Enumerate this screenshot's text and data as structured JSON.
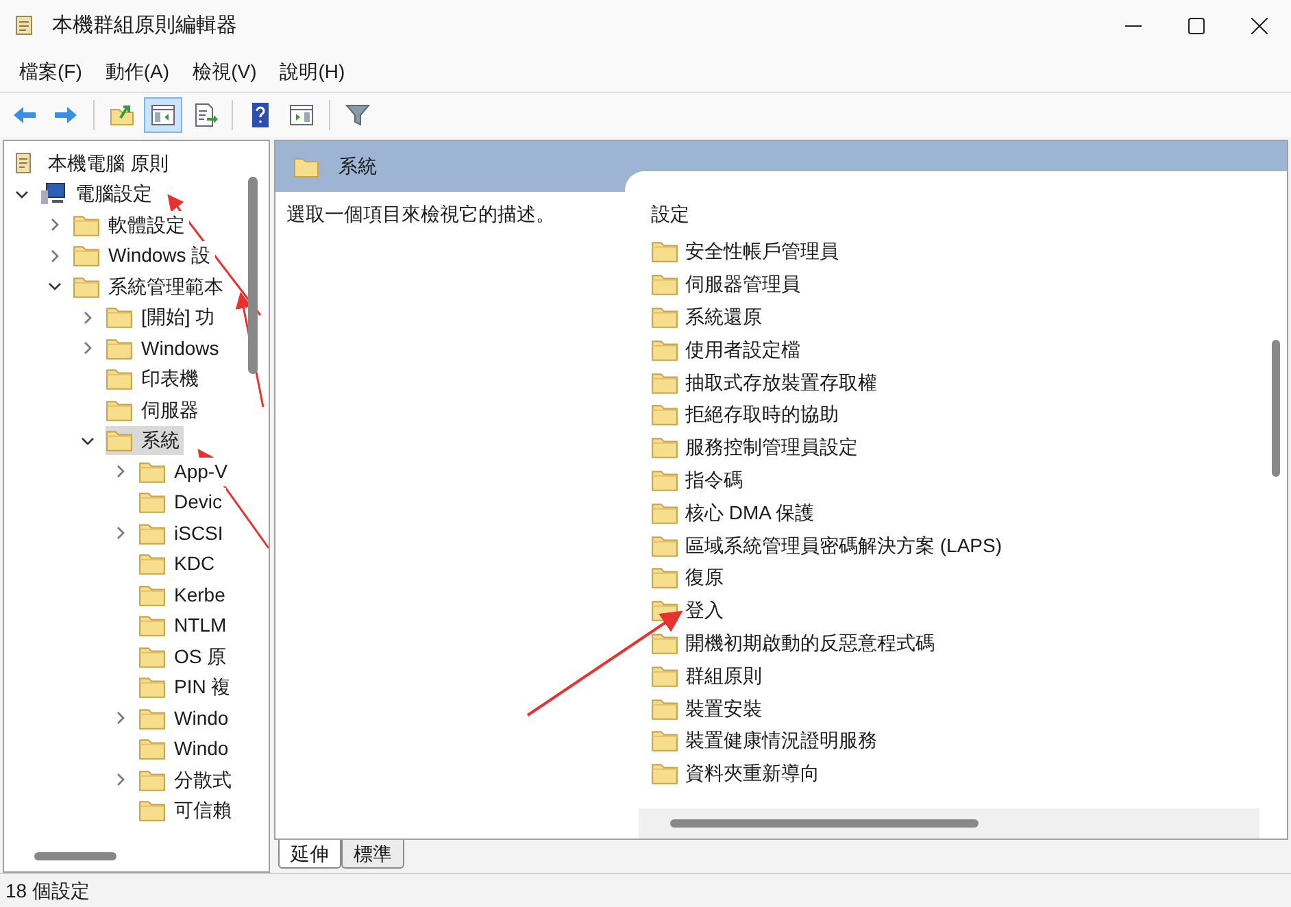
{
  "window": {
    "title": "本機群組原則編輯器"
  },
  "menu": [
    "檔案(F)",
    "動作(A)",
    "檢視(V)",
    "說明(H)"
  ],
  "toolbar": [
    {
      "kind": "back",
      "pressed": false
    },
    {
      "kind": "forward",
      "pressed": false
    },
    {
      "kind": "up",
      "pressed": false
    },
    {
      "kind": "tree",
      "pressed": true
    },
    {
      "kind": "export",
      "pressed": false
    },
    {
      "kind": "help",
      "pressed": false
    },
    {
      "kind": "pane",
      "pressed": false
    },
    {
      "kind": "filter",
      "pressed": false
    }
  ],
  "tree": {
    "label": "本機電腦 原則",
    "children": [
      {
        "label": "電腦設定",
        "kind": "computer",
        "expanded": true,
        "selected": false,
        "children": [
          {
            "label": "軟體設定",
            "expanded": false,
            "selected": false
          },
          {
            "label": "Windows 設",
            "expanded": false,
            "selected": false
          },
          {
            "label": "系統管理範本",
            "expanded": true,
            "selected": false,
            "children": [
              {
                "label": "[開始] 功",
                "expanded": false,
                "selected": false
              },
              {
                "label": "Windows",
                "expanded": false,
                "selected": false
              },
              {
                "label": "印表機",
                "selected": false
              },
              {
                "label": "伺服器",
                "selected": false
              },
              {
                "label": "系統",
                "expanded": true,
                "selected": true,
                "children": [
                  {
                    "label": "App-V",
                    "expanded": false,
                    "selected": false
                  },
                  {
                    "label": "Devic",
                    "selected": false
                  },
                  {
                    "label": "iSCSI",
                    "expanded": false,
                    "selected": false
                  },
                  {
                    "label": "KDC",
                    "selected": false
                  },
                  {
                    "label": "Kerbe",
                    "selected": false
                  },
                  {
                    "label": "NTLM",
                    "selected": false
                  },
                  {
                    "label": "OS 原",
                    "selected": false
                  },
                  {
                    "label": "PIN 複",
                    "selected": false
                  },
                  {
                    "label": "Windo",
                    "expanded": false,
                    "selected": false
                  },
                  {
                    "label": "Windo",
                    "selected": false
                  },
                  {
                    "label": "分散式",
                    "expanded": false,
                    "selected": false
                  },
                  {
                    "label": "可信賴",
                    "selected": false
                  }
                ]
              }
            ]
          }
        ]
      }
    ]
  },
  "details": {
    "title": "系統",
    "description": "選取一個項目來檢視它的描述。",
    "column": "設定",
    "items": [
      "安全性帳戶管理員",
      "伺服器管理員",
      "系統還原",
      "使用者設定檔",
      "抽取式存放裝置存取權",
      "拒絕存取時的協助",
      "服務控制管理員設定",
      "指令碼",
      "核心 DMA 保護",
      "區域系統管理員密碼解決方案 (LAPS)",
      "復原",
      "登入",
      "開機初期啟動的反惡意程式碼",
      "群組原則",
      "裝置安裝",
      "裝置健康情況證明服務",
      "資料夾重新導向"
    ]
  },
  "tabs": [
    {
      "label": "延伸",
      "selected": true
    },
    {
      "label": "標準",
      "selected": false
    }
  ],
  "status_bar": "18 個設定"
}
